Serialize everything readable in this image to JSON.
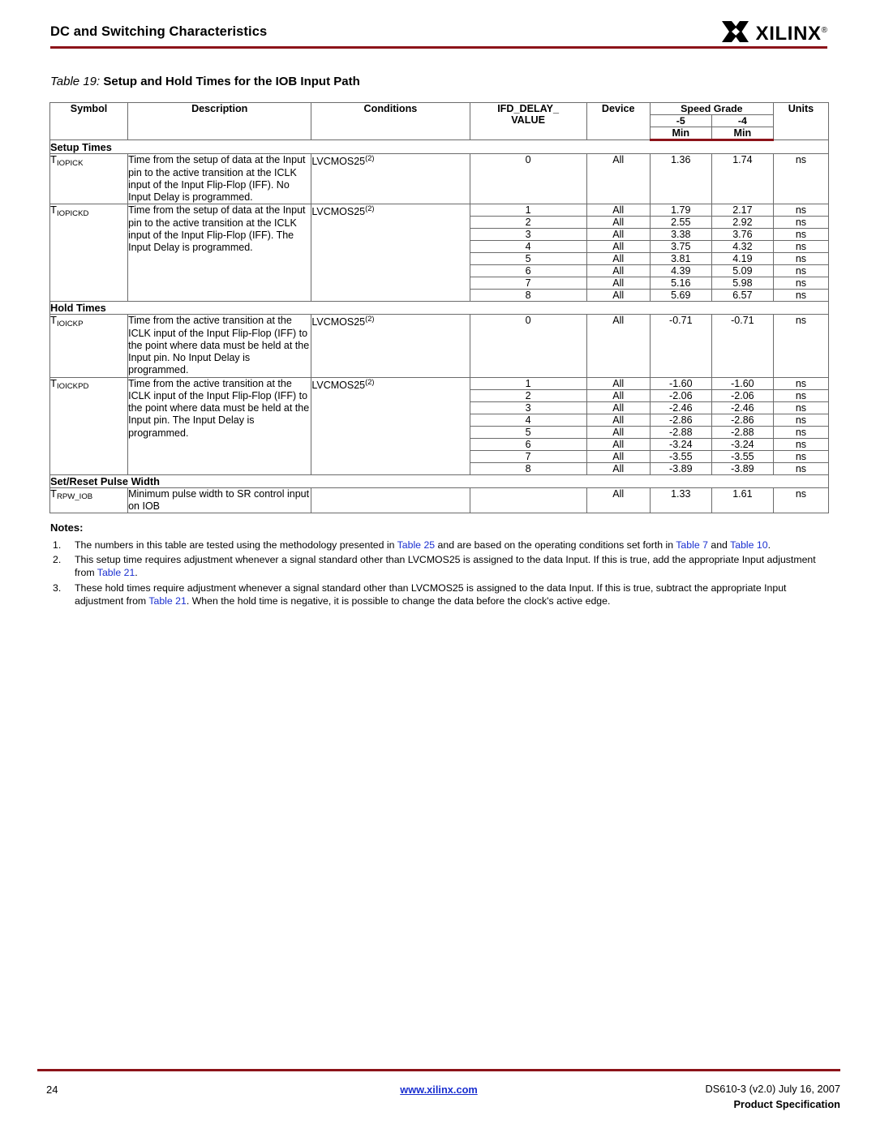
{
  "header": {
    "section_title": "DC and Switching Characteristics",
    "logo_text": "XILINX",
    "logo_reg": "®",
    "rule_color": "#8c1319"
  },
  "caption": {
    "table_word": "Table",
    "table_number": "19:",
    "title": "Setup and Hold Times for the IOB Input Path"
  },
  "table": {
    "columns": {
      "symbol": "Symbol",
      "description": "Description",
      "conditions": "Conditions",
      "ifd_delay_value": "IFD_DELAY_",
      "ifd_delay_value2": "VALUE",
      "device": "Device",
      "speed_grade": "Speed Grade",
      "grade_5": "-5",
      "grade_4": "-4",
      "min_5": "Min",
      "min_4": "Min",
      "units": "Units"
    },
    "sections": [
      {
        "label": "Setup Times",
        "entries": [
          {
            "symbol_base": "T",
            "symbol_sub": "IOPICK",
            "description": "Time from the setup of data at the Input pin to the active transition at the ICLK input of the Input Flip-Flop (IFF). No Input Delay is programmed.",
            "conditions": "LVCMOS25",
            "conditions_note": "(2)",
            "rows": [
              {
                "ifd_delay_value": "0",
                "device": "All",
                "min_5": "1.36",
                "min_4": "1.74",
                "units": "ns"
              }
            ]
          },
          {
            "symbol_base": "T",
            "symbol_sub": "IOPICKD",
            "description": "Time from the setup of data at the Input pin to the active transition at the ICLK input of the Input Flip-Flop (IFF). The Input Delay is programmed.",
            "conditions": "LVCMOS25",
            "conditions_note": "(2)",
            "rows": [
              {
                "ifd_delay_value": "1",
                "device": "All",
                "min_5": "1.79",
                "min_4": "2.17",
                "units": "ns"
              },
              {
                "ifd_delay_value": "2",
                "device": "All",
                "min_5": "2.55",
                "min_4": "2.92",
                "units": "ns"
              },
              {
                "ifd_delay_value": "3",
                "device": "All",
                "min_5": "3.38",
                "min_4": "3.76",
                "units": "ns"
              },
              {
                "ifd_delay_value": "4",
                "device": "All",
                "min_5": "3.75",
                "min_4": "4.32",
                "units": "ns"
              },
              {
                "ifd_delay_value": "5",
                "device": "All",
                "min_5": "3.81",
                "min_4": "4.19",
                "units": "ns"
              },
              {
                "ifd_delay_value": "6",
                "device": "All",
                "min_5": "4.39",
                "min_4": "5.09",
                "units": "ns"
              },
              {
                "ifd_delay_value": "7",
                "device": "All",
                "min_5": "5.16",
                "min_4": "5.98",
                "units": "ns"
              },
              {
                "ifd_delay_value": "8",
                "device": "All",
                "min_5": "5.69",
                "min_4": "6.57",
                "units": "ns"
              }
            ]
          }
        ]
      },
      {
        "label": "Hold Times",
        "entries": [
          {
            "symbol_base": "T",
            "symbol_sub": "IOICKP",
            "description": "Time from the active transition at the ICLK input of the Input Flip-Flop (IFF) to the point where data must be held at the Input pin. No Input Delay is programmed.",
            "conditions": "LVCMOS25",
            "conditions_note": "(2)",
            "rows": [
              {
                "ifd_delay_value": "0",
                "device": "All",
                "min_5": "-0.71",
                "min_4": "-0.71",
                "units": "ns"
              }
            ]
          },
          {
            "symbol_base": "T",
            "symbol_sub": "IOICKPD",
            "description": "Time from the active transition at the ICLK input of the Input Flip-Flop (IFF) to the point where data must be held at the Input pin. The Input Delay is programmed.",
            "conditions": "LVCMOS25",
            "conditions_note": "(2)",
            "rows": [
              {
                "ifd_delay_value": "1",
                "device": "All",
                "min_5": "-1.60",
                "min_4": "-1.60",
                "units": "ns"
              },
              {
                "ifd_delay_value": "2",
                "device": "All",
                "min_5": "-2.06",
                "min_4": "-2.06",
                "units": "ns"
              },
              {
                "ifd_delay_value": "3",
                "device": "All",
                "min_5": "-2.46",
                "min_4": "-2.46",
                "units": "ns"
              },
              {
                "ifd_delay_value": "4",
                "device": "All",
                "min_5": "-2.86",
                "min_4": "-2.86",
                "units": "ns"
              },
              {
                "ifd_delay_value": "5",
                "device": "All",
                "min_5": "-2.88",
                "min_4": "-2.88",
                "units": "ns"
              },
              {
                "ifd_delay_value": "6",
                "device": "All",
                "min_5": "-3.24",
                "min_4": "-3.24",
                "units": "ns"
              },
              {
                "ifd_delay_value": "7",
                "device": "All",
                "min_5": "-3.55",
                "min_4": "-3.55",
                "units": "ns"
              },
              {
                "ifd_delay_value": "8",
                "device": "All",
                "min_5": "-3.89",
                "min_4": "-3.89",
                "units": "ns"
              }
            ]
          }
        ]
      },
      {
        "label": "Set/Reset Pulse Width",
        "entries": [
          {
            "symbol_base": "T",
            "symbol_sub": "RPW_IOB",
            "description": "Minimum pulse width to SR control input on IOB",
            "conditions": "",
            "conditions_note": "",
            "conditions_shaded": true,
            "ifd_shaded": true,
            "rows": [
              {
                "ifd_delay_value": "",
                "device": "All",
                "min_5": "1.33",
                "min_4": "1.61",
                "units": "ns"
              }
            ]
          }
        ]
      }
    ]
  },
  "notes": {
    "title": "Notes:",
    "items": [
      {
        "number": "1.",
        "parts": [
          {
            "t": "The numbers in this table are tested using the methodology presented in "
          },
          {
            "t": "Table 25",
            "link": true
          },
          {
            "t": " and are based on the operating conditions set forth in "
          },
          {
            "t": "Table 7",
            "link": true
          },
          {
            "t": " and "
          },
          {
            "t": "Table 10",
            "link": true
          },
          {
            "t": "."
          }
        ]
      },
      {
        "number": "2.",
        "parts": [
          {
            "t": "This setup time requires adjustment whenever a signal standard other than LVCMOS25 is assigned to the data Input. If this is true, add the appropriate Input adjustment from "
          },
          {
            "t": "Table 21",
            "link": true
          },
          {
            "t": "."
          }
        ]
      },
      {
        "number": "3.",
        "parts": [
          {
            "t": "These hold times require adjustment whenever a signal standard other than LVCMOS25 is assigned to the data Input. If this is true, subtract the appropriate Input adjustment from "
          },
          {
            "t": "Table 21",
            "link": true
          },
          {
            "t": ". When the hold time is negative, it is possible to change the data before the clock's active edge."
          }
        ]
      }
    ]
  },
  "footer": {
    "page_number": "24",
    "url": "www.xilinx.com",
    "doc_id": "DS610-3 (v2.0) July 16, 2007",
    "doc_type": "Product Specification"
  }
}
